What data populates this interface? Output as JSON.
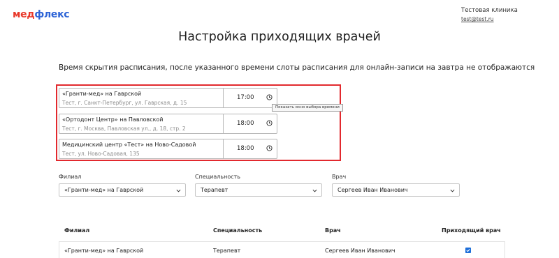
{
  "header": {
    "logo_part1": "мед",
    "logo_part2": "флекс",
    "clinic_name": "Тестовая клиника",
    "email": "test@test.ru"
  },
  "page": {
    "title": "Настройка приходящих врачей",
    "subtitle": "Время скрытия расписания, после указанного времени слоты расписания для онлайн-записи на завтра не отображаются"
  },
  "clinics": [
    {
      "name": "«Гранти-мед» на Гаврской",
      "address": "Тест, г. Санкт-Петербург, ул. Гаврская, д. 15",
      "time": "17:00"
    },
    {
      "name": "«Ортодонт Центр» на Павловской",
      "address": "Тест, г. Москва, Павловская ул., д. 18, стр. 2",
      "time": "18:00"
    },
    {
      "name": "Медицинский центр «Тест» на Ново-Садовой",
      "address": "Тест, ул. Ново-Садовая, 135",
      "time": "18:00"
    }
  ],
  "tooltip": "Показать окно выбора времени",
  "filters": {
    "branch": {
      "label": "Филиал",
      "value": "«Гранти-мед» на Гаврской"
    },
    "specialty": {
      "label": "Специальность",
      "value": "Терапевт"
    },
    "doctor": {
      "label": "Врач",
      "value": "Сергеев Иван Иванович"
    }
  },
  "table": {
    "headers": {
      "branch": "Филиал",
      "specialty": "Специальность",
      "doctor": "Врач",
      "visiting": "Приходящий врач"
    },
    "rows": [
      {
        "branch": "«Гранти-мед» на Гаврской",
        "specialty": "Терапевт",
        "doctor": "Сергеев Иван Иванович",
        "visiting": true
      }
    ]
  },
  "colors": {
    "accent_red": "#e2292e",
    "logo_red": "#e8392b",
    "logo_blue": "#2c63d6",
    "checkbox_blue": "#1e6fd9"
  }
}
